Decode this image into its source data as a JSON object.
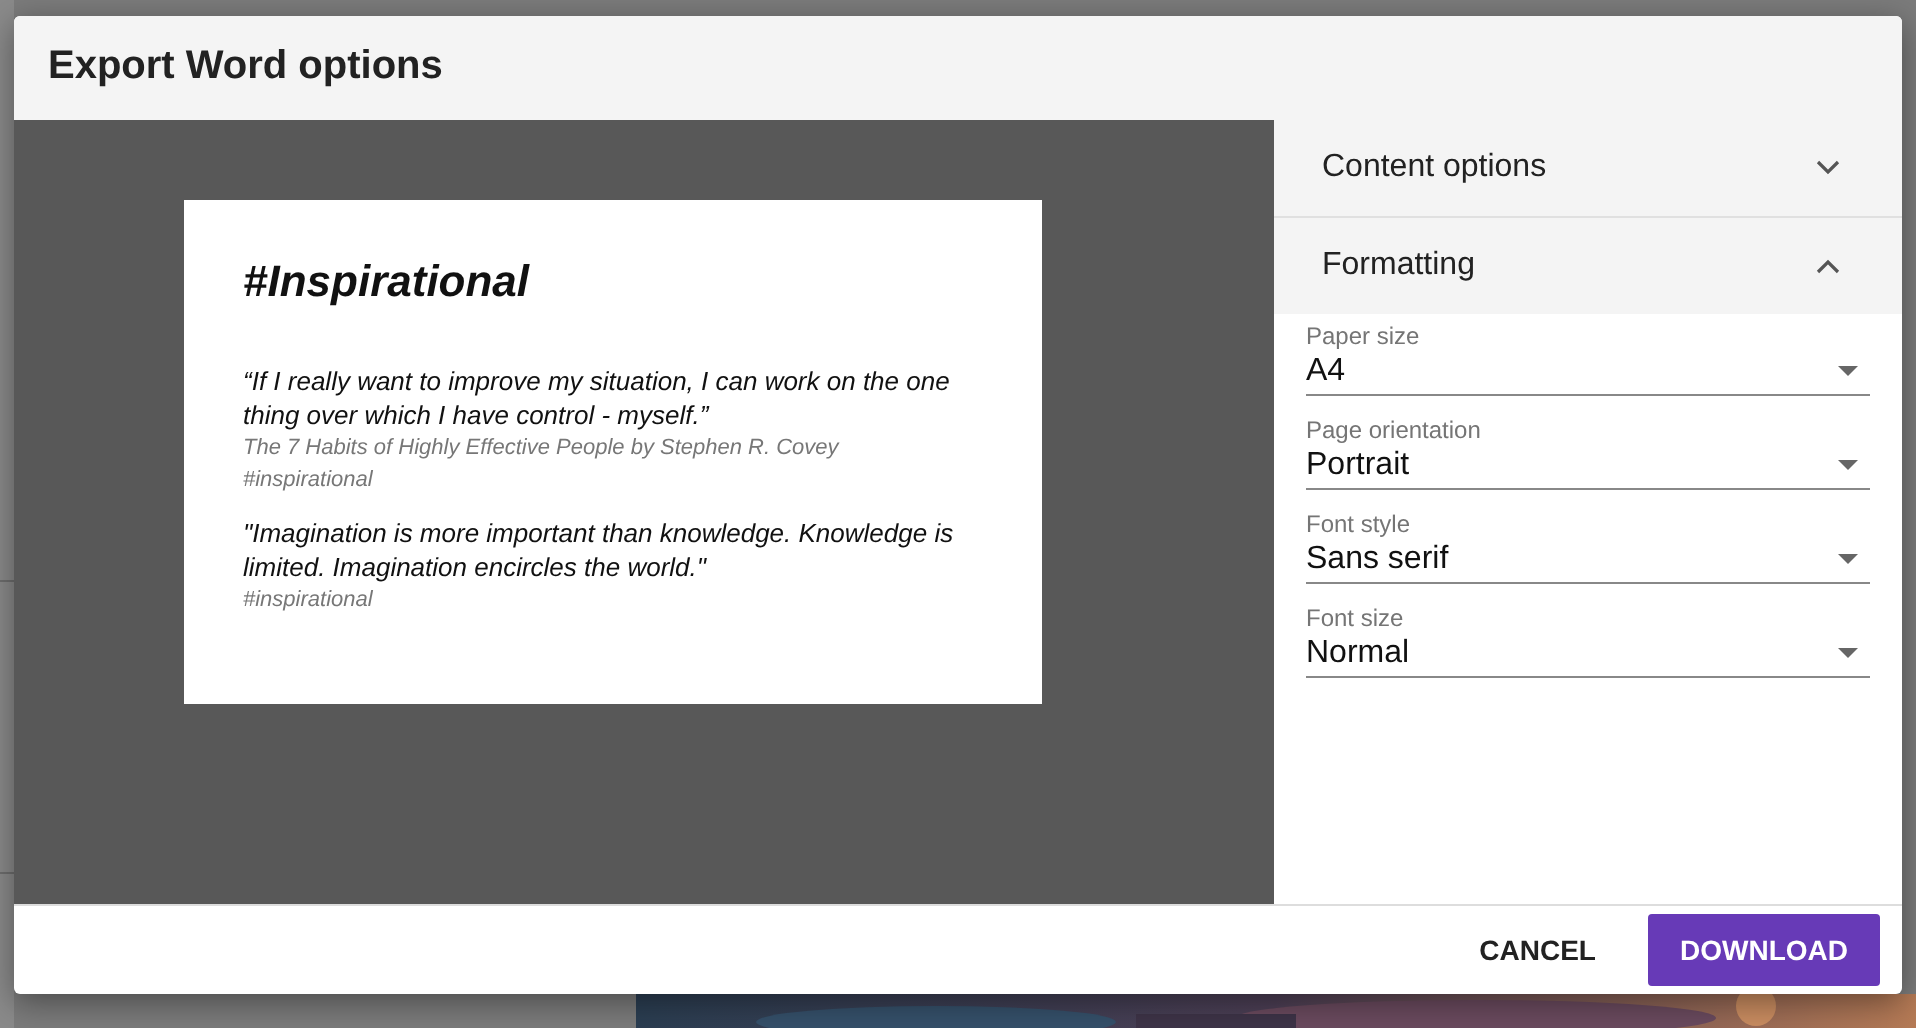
{
  "dialog": {
    "title": "Export Word options",
    "preview": {
      "heading": "#Inspirational",
      "quotes": [
        {
          "text": "“If I really want to improve my situation, I can work on the one thing over which I have control - myself.”",
          "source": "The 7 Habits of Highly Effective People by Stephen R. Covey",
          "tag": "#inspirational"
        },
        {
          "text": "\"Imagination is more important than knowledge. Knowledge is limited. Imagination encircles the world.\"",
          "tag": "#inspirational"
        }
      ]
    },
    "sections": [
      {
        "title": "Content options",
        "expanded": false
      },
      {
        "title": "Formatting",
        "expanded": true,
        "fields": [
          {
            "label": "Paper size",
            "value": "A4"
          },
          {
            "label": "Page orientation",
            "value": "Portrait"
          },
          {
            "label": "Font style",
            "value": "Sans serif"
          },
          {
            "label": "Font size",
            "value": "Normal"
          }
        ]
      }
    ],
    "buttons": [
      {
        "label": "CANCEL",
        "kind": "text"
      },
      {
        "label": "DOWNLOAD",
        "kind": "primary"
      }
    ]
  }
}
